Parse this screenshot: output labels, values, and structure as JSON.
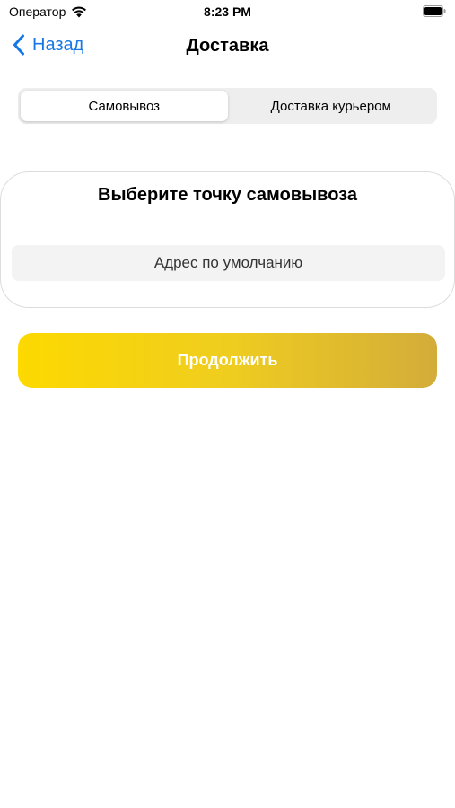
{
  "status_bar": {
    "carrier": "Оператор",
    "time": "8:23 PM",
    "wifi_icon": "wifi-icon",
    "battery_icon": "battery-icon"
  },
  "nav": {
    "back_label": "Назад",
    "title": "Доставка",
    "back_icon": "chevron-left-icon"
  },
  "segmented": {
    "options": [
      "Самовывоз",
      "Доставка курьером"
    ],
    "selected_index": 0
  },
  "pickup_card": {
    "title": "Выберите точку самовывоза",
    "address_value": "Адрес по умолчанию"
  },
  "continue_button": {
    "label": "Продолжить"
  },
  "colors": {
    "accent_link": "#1677e6",
    "button_gradient_start": "#fdd900",
    "button_gradient_end": "#d3ac3a",
    "segment_background": "#eeeeef",
    "field_background": "#f3f3f4"
  }
}
